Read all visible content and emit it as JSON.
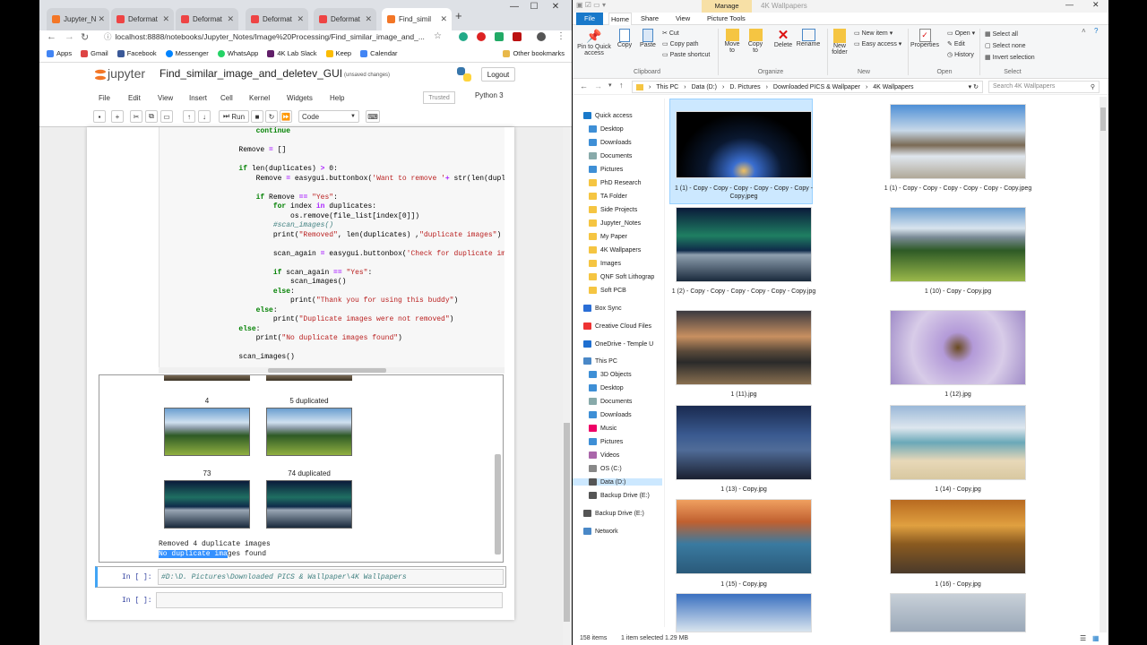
{
  "chrome": {
    "tabs": [
      "Jupyter_N",
      "Deformat",
      "Deformat",
      "Deformat",
      "Deformat",
      "Find_simil"
    ],
    "url": "localhost:8888/notebooks/Jupyter_Notes/Image%20Processing/Find_similar_image_and_...",
    "bookmarks": [
      "Apps",
      "Gmail",
      "Facebook",
      "Messenger",
      "WhatsApp",
      "4K Lab Slack",
      "Keep",
      "Calendar",
      "Other bookmarks"
    ]
  },
  "jupyter": {
    "logo": "jupyter",
    "title": "Find_similar_image_and_deletev_GUI",
    "saved": "(unsaved changes)",
    "logout": "Logout",
    "menu": [
      "File",
      "Edit",
      "View",
      "Insert",
      "Cell",
      "Kernel",
      "Widgets",
      "Help"
    ],
    "trusted": "Trusted",
    "kernel": "Python 3",
    "run": "Run",
    "celltype": "Code"
  },
  "output": {
    "labels": [
      "4",
      "5 duplicated",
      "73",
      "74 duplicated"
    ],
    "line1": "Removed 4 duplicate images",
    "line2_sel": "No duplicate ima",
    "line2_rest": "ges found"
  },
  "cells": {
    "prompt1": "In [ ]:",
    "cell1": "#D:\\D. Pictures\\Downloaded PICS & Wallpaper\\4K Wallpapers",
    "prompt2": "In [ ]:"
  },
  "explorer": {
    "manage": "Manage",
    "title": "4K Wallpapers",
    "ribbon_tabs": [
      "File",
      "Home",
      "Share",
      "View",
      "Picture Tools"
    ],
    "clipboard": {
      "pin": "Pin to Quick access",
      "copy": "Copy",
      "paste": "Paste",
      "cut": "Cut",
      "copy_path": "Copy path",
      "paste_shortcut": "Paste shortcut",
      "group": "Clipboard"
    },
    "organize": {
      "move": "Move to",
      "copy": "Copy to",
      "delete": "Delete",
      "rename": "Rename",
      "group": "Organize"
    },
    "new": {
      "folder": "New folder",
      "item": "New item",
      "easy": "Easy access",
      "group": "New"
    },
    "open": {
      "props": "Properties",
      "open": "Open",
      "edit": "Edit",
      "history": "History",
      "group": "Open"
    },
    "select": {
      "all": "Select all",
      "none": "Select none",
      "invert": "Invert selection",
      "group": "Select"
    },
    "breadcrumb": [
      "This PC",
      "Data (D:)",
      "D. Pictures",
      "Downloaded PICS & Wallpaper",
      "4K Wallpapers"
    ],
    "search": "Search 4K Wallpapers",
    "nav": [
      "Quick access",
      "Desktop",
      "Downloads",
      "Documents",
      "Pictures",
      "PhD Research",
      "TA Folder",
      "Side Projects",
      "Jupyter_Notes",
      "My Paper",
      "4K Wallpapers",
      "Images",
      "QNF Soft Lithograp",
      "Soft PCB",
      "Box Sync",
      "Creative Cloud Files",
      "OneDrive - Temple U",
      "This PC",
      "3D Objects",
      "Desktop",
      "Documents",
      "Downloads",
      "Music",
      "Pictures",
      "Videos",
      "OS (C:)",
      "Data (D:)",
      "Backup Drive (E:)",
      "Backup Drive (E:)",
      "Network"
    ],
    "files": [
      "1 (1) - Copy - Copy - Copy - Copy - Copy - Copy - Copy.jpeg",
      "1 (1) - Copy - Copy - Copy - Copy - Copy - Copy.jpeg",
      "1 (2) - Copy - Copy - Copy - Copy - Copy - Copy.jpg",
      "1 (10) - Copy - Copy.jpg",
      "1 (11).jpg",
      "1 (12).jpg",
      "1 (13) - Copy.jpg",
      "1 (14) - Copy.jpg",
      "1 (15) - Copy.jpg",
      "1 (16) - Copy.jpg"
    ],
    "status_items": "158 items",
    "status_sel": "1 item selected  1.29 MB"
  }
}
